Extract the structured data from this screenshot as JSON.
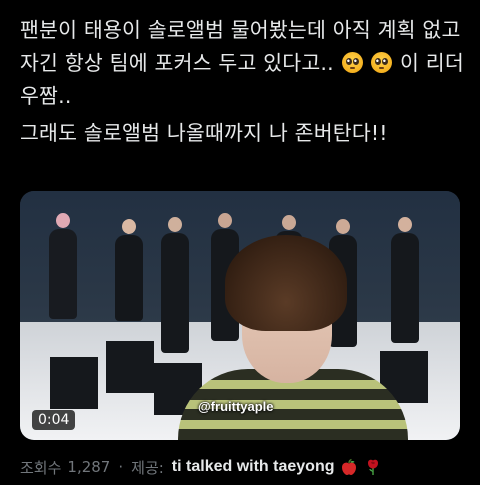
{
  "tweet": {
    "paragraph1_a": "팬분이 태용이 솔로앨범 물어봤는데 아직 계획 없고 자긴 항상 팀에 포커스 두고 있다고..",
    "paragraph1_b": " 이 리더 우짬..",
    "emoji": [
      "pleading-face",
      "pleading-face"
    ],
    "paragraph2": "그래도 솔로앨범 나올때까지 나 존버탄다!!"
  },
  "media": {
    "watermark": "@fruittyaple",
    "duration": "0:04"
  },
  "meta": {
    "views_label": "조회수",
    "views_count": "1,287",
    "separator": "·",
    "source_label": "제공:",
    "source_name": "ti talked with taeyong",
    "source_icons": [
      "apple-icon",
      "rose-icon"
    ]
  },
  "colors": {
    "background": "#000000",
    "text": "#e7e9ea",
    "muted": "#71767b"
  }
}
